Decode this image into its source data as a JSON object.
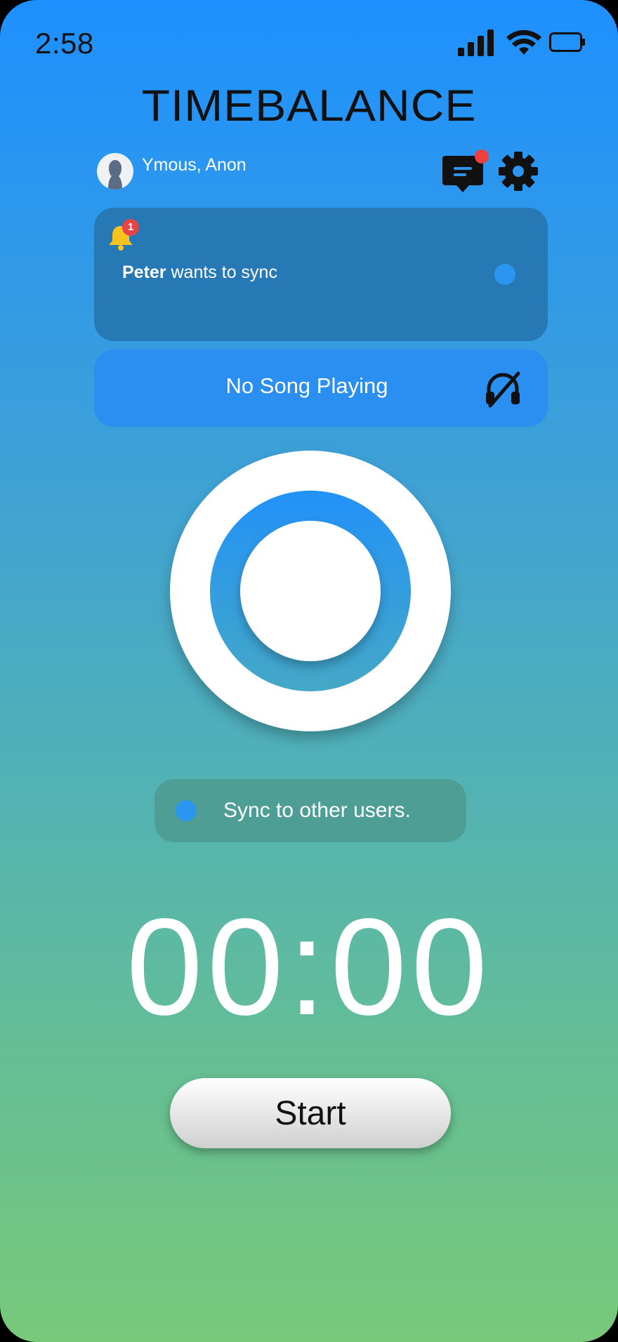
{
  "status_bar": {
    "time": "2:58",
    "icons": [
      "signal-icon",
      "wifi-icon",
      "battery-icon"
    ]
  },
  "app": {
    "title": "TIMEBALANCE"
  },
  "user": {
    "name": "Ymous, Anon"
  },
  "notification": {
    "badge_count": "1",
    "sender": "Peter",
    "message": "wants to sync"
  },
  "song": {
    "label": "No Song Playing"
  },
  "sync": {
    "label": "Sync to other users."
  },
  "timer": {
    "display": "00:00"
  },
  "start_button": {
    "label": "Start"
  },
  "colors": {
    "gradient_top": "#1e90ff",
    "gradient_bottom": "#78c97a",
    "accent_blue": "#2b95f0",
    "notification_red": "#e94444"
  }
}
